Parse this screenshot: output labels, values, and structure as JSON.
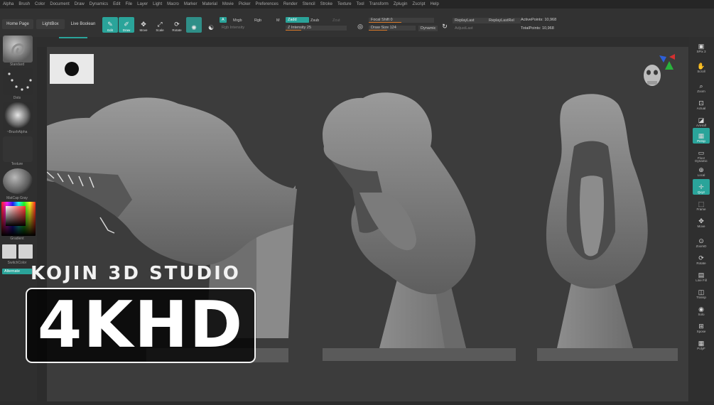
{
  "menu": [
    "Alpha",
    "Brush",
    "Color",
    "Document",
    "Draw",
    "Dynamics",
    "Edit",
    "File",
    "Layer",
    "Light",
    "Macro",
    "Marker",
    "Material",
    "Movie",
    "Picker",
    "Preferences",
    "Render",
    "Stencil",
    "Stroke",
    "Texture",
    "Tool",
    "Transform",
    "Zplugin",
    "Zscript",
    "Help"
  ],
  "toolbar": {
    "home_page": "Home Page",
    "lightbox": "LightBox",
    "live_boolean": "Live Boolean",
    "tools": [
      {
        "label": "Edit",
        "icon": "edit-icon",
        "on": true
      },
      {
        "label": "Draw",
        "icon": "draw-icon",
        "on": true
      },
      {
        "label": "Move",
        "icon": "move-icon",
        "on": false
      },
      {
        "label": "Scale",
        "icon": "scale-icon",
        "on": false
      },
      {
        "label": "Rotate",
        "icon": "rotate-icon",
        "on": false
      }
    ],
    "a_label": "A",
    "mrgb": "Mrgb",
    "rgb": "Rgb",
    "m": "M",
    "zadd": "Zadd",
    "zsub": "Zsub",
    "zcut": "Zcut",
    "rgb_intensity": "Rgb Intensity",
    "z_intensity": "Z Intensity 25",
    "focal_shift": "Focal Shift 0",
    "draw_size": "Draw Size 124",
    "dynamic": "Dynamic",
    "replay_last": "ReplayLast",
    "replay_last_rel": "ReplayLastRel",
    "adjust_last": "AdjustLast",
    "active_points": "ActivePoints: 10,968",
    "total_points": "TotalPoints: 10,968"
  },
  "left_shelf": {
    "standard": "Standard",
    "dots": "Dots",
    "brush_alpha": "~BrushAlpha",
    "texture": "Texture",
    "material": "MatCap Gray",
    "gradient": "Gradient",
    "switch_color": "SwitchColor",
    "alternate": "Alternate"
  },
  "right_shelf": [
    {
      "label": "SPix 3",
      "icon": "bpr-icon"
    },
    {
      "label": "Scroll",
      "icon": "scroll-icon"
    },
    {
      "label": "Zoom",
      "icon": "zoom-icon"
    },
    {
      "label": "Actual",
      "icon": "actual-icon"
    },
    {
      "label": "AAHalf",
      "icon": "aahalf-icon"
    },
    {
      "label": "Persp",
      "icon": "persp-icon"
    },
    {
      "label": "Floor",
      "icon": "floor-icon"
    },
    {
      "label": "Local",
      "icon": "local-icon"
    },
    {
      "label": "Qxyz",
      "icon": "xyz-icon"
    },
    {
      "label": "Frame",
      "icon": "frame-icon"
    },
    {
      "label": "Move",
      "icon": "move-view-icon"
    },
    {
      "label": "ZoomD",
      "icon": "zoom3d-icon"
    },
    {
      "label": "Rotate",
      "icon": "rotate-view-icon"
    },
    {
      "label": "Line Fill",
      "icon": "linefill-icon"
    },
    {
      "label": "Transp",
      "icon": "transp-icon"
    },
    {
      "label": "Solo",
      "icon": "solo-icon"
    },
    {
      "label": "Xpose",
      "icon": "xpose-icon"
    }
  ],
  "right_shelf_extra": {
    "dynamic": "Dynamic",
    "polyf": "PolyF"
  },
  "overlay": {
    "studio": "KOJIN 3D STUDIO",
    "quality": "4KHD"
  },
  "colors": {
    "accent": "#2aa49a",
    "canvas": "#3c3c3c",
    "panel": "#2f2f2f"
  }
}
